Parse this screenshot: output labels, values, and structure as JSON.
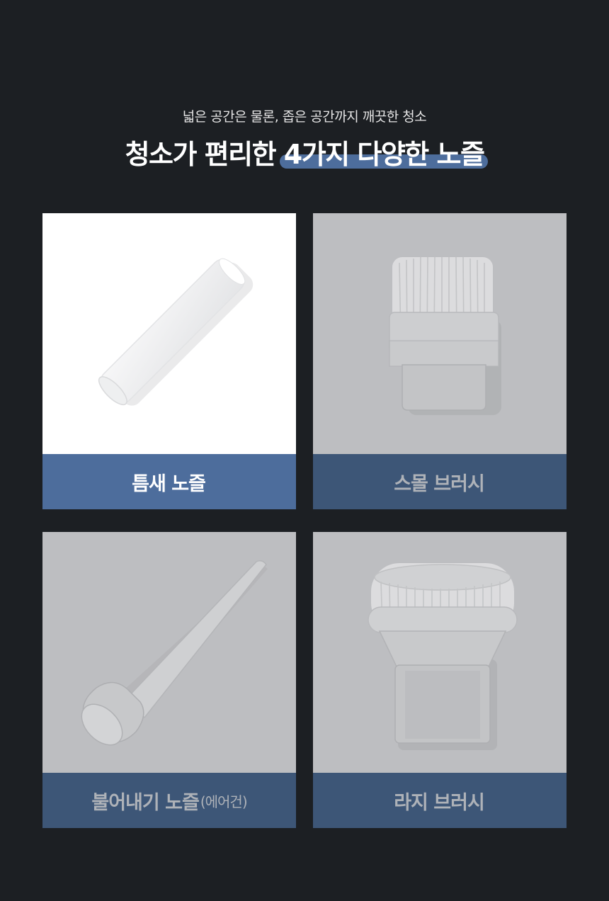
{
  "header": {
    "subtitle": "넓은 공간은 물론, 좁은 공간까지 깨끗한 청소",
    "title_prefix": "청소가 편리한 ",
    "title_highlight": "4가지 다양한 노즐"
  },
  "colors": {
    "background": "#1c1f23",
    "accent": "#4d6d9c",
    "label_dim": "#3d5677",
    "image_dim": "#bdbec1"
  },
  "cards": [
    {
      "label": "틈새 노즐",
      "label_suffix": "",
      "icon": "crevice-nozzle-image",
      "state": "active"
    },
    {
      "label": "스몰 브러시",
      "label_suffix": "",
      "icon": "small-brush-image",
      "state": "dim"
    },
    {
      "label": "불어내기 노즐",
      "label_suffix": "(에어건)",
      "icon": "air-blow-nozzle-image",
      "state": "dim"
    },
    {
      "label": "라지 브러시",
      "label_suffix": "",
      "icon": "large-brush-image",
      "state": "dim"
    }
  ]
}
